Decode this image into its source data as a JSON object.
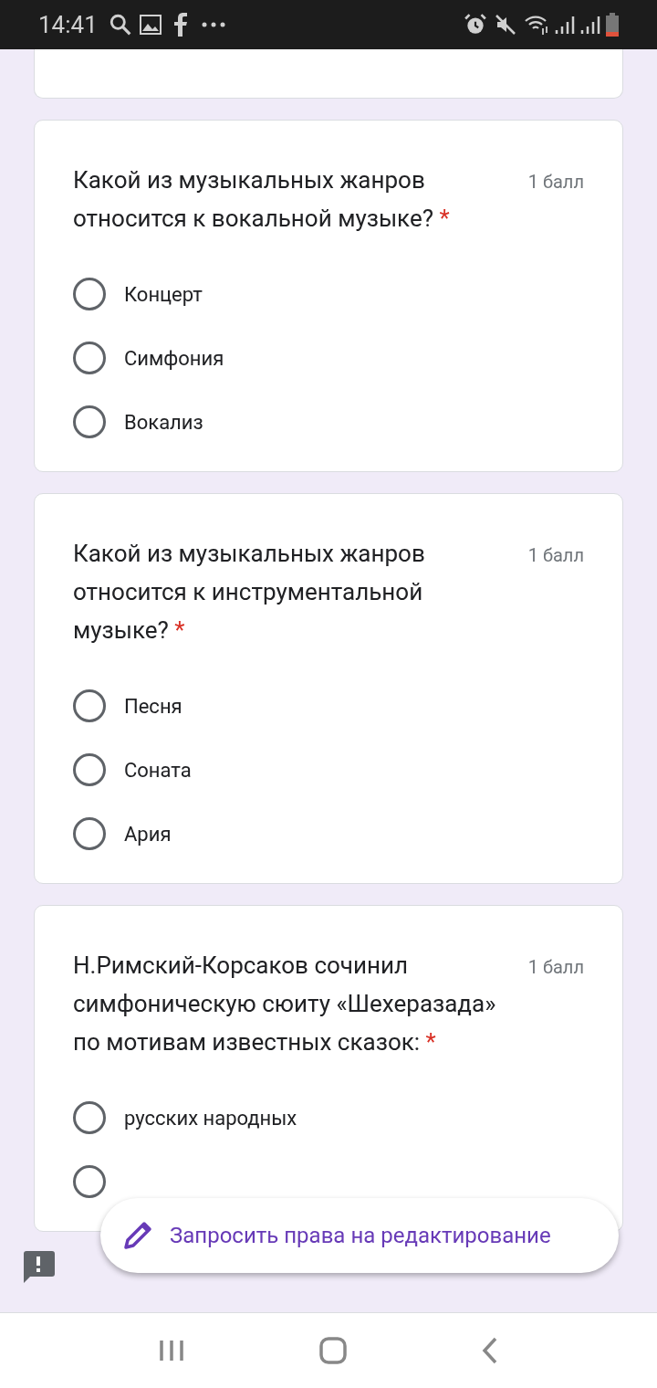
{
  "status_bar": {
    "time": "14:41"
  },
  "questions": [
    {
      "title": "Какой из музыкальных жанров относится к вокальной музыке?",
      "required_mark": "*",
      "points": "1 балл",
      "options": [
        {
          "label": "Концерт",
          "selected": false
        },
        {
          "label": "Симфония",
          "selected": false
        },
        {
          "label": "Вокализ",
          "selected": false
        }
      ]
    },
    {
      "title": "Какой из музыкальных жанров относится к инструментальной музыке?",
      "required_mark": "*",
      "points": "1 балл",
      "options": [
        {
          "label": "Песня",
          "selected": false
        },
        {
          "label": "Соната",
          "selected": false
        },
        {
          "label": "Ария",
          "selected": false
        }
      ]
    },
    {
      "title": "Н.Римский-Корсаков сочинил симфоническую сюиту «Шехеразада» по мотивам известных сказок:",
      "required_mark": "*",
      "points": "1 балл",
      "options": [
        {
          "label": "русских народных",
          "selected": false
        },
        {
          "selected": false
        }
      ]
    }
  ],
  "fab": {
    "label": "Запросить права на редактирование"
  }
}
